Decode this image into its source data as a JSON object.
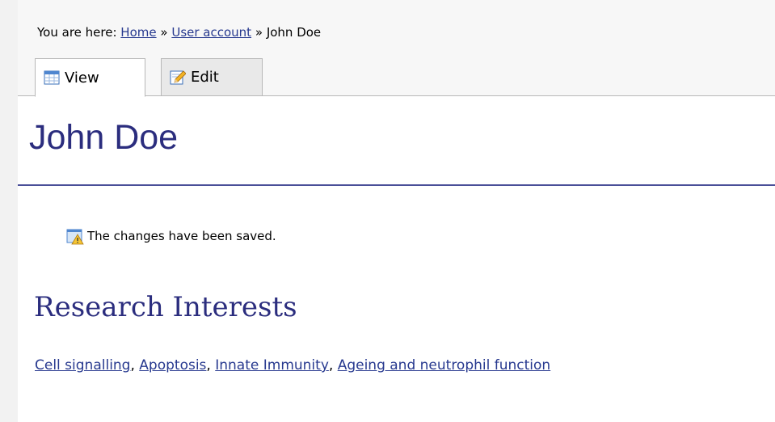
{
  "breadcrumb": {
    "prefix": "You are here:",
    "items": [
      {
        "label": "Home"
      },
      {
        "label": "User account"
      }
    ],
    "separator": "»",
    "current": "John Doe"
  },
  "tabs": [
    {
      "label": "View",
      "icon": "table-view-icon",
      "active": true
    },
    {
      "label": "Edit",
      "icon": "pencil-edit-icon",
      "active": false
    }
  ],
  "page_title": "John Doe",
  "status_message": {
    "text": "The changes have been saved.",
    "icon": "warning-icon"
  },
  "research": {
    "heading": "Research Interests",
    "items": [
      {
        "label": "Cell signalling"
      },
      {
        "label": "Apoptosis"
      },
      {
        "label": "Innate Immunity"
      },
      {
        "label": "Ageing and neutrophil function"
      }
    ],
    "separator": ","
  },
  "colors": {
    "heading": "#2b2d7e",
    "link": "#27398f",
    "rule": "#4a4f98"
  }
}
